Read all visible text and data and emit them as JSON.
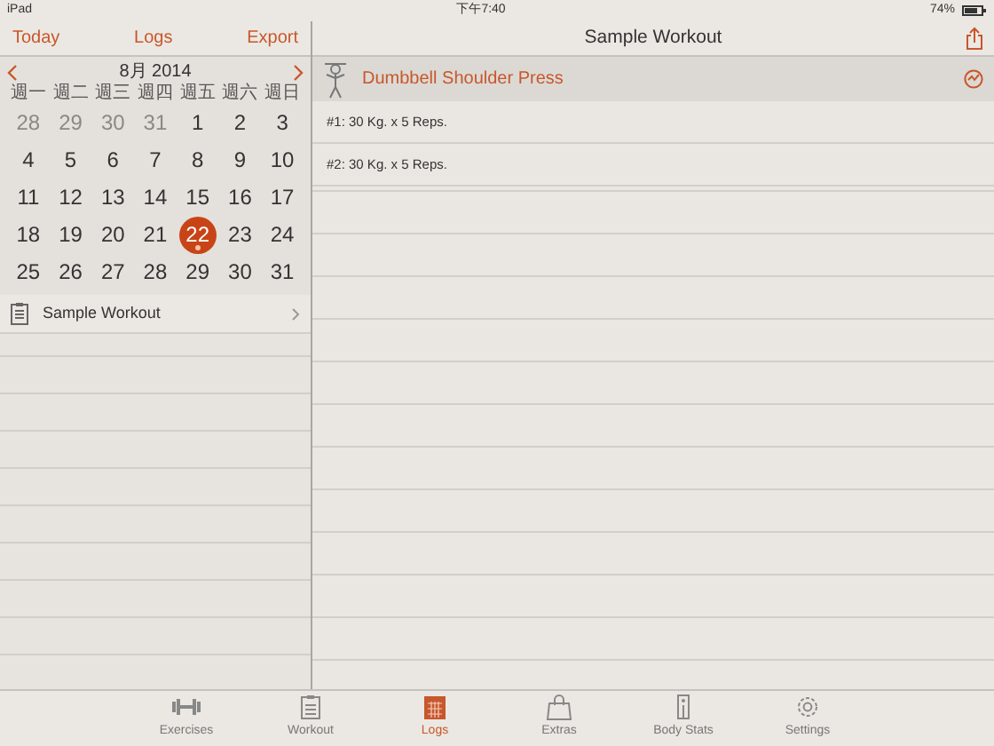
{
  "status_bar": {
    "device": "iPad",
    "time": "下午7:40",
    "battery": "74%"
  },
  "left_nav": {
    "buttons": [
      "Today",
      "Logs",
      "Export"
    ]
  },
  "calendar": {
    "month": "8月 2014",
    "weekdays": [
      "週一",
      "週二",
      "週三",
      "週四",
      "週五",
      "週六",
      "週日"
    ],
    "weeks": [
      [
        {
          "label": "28",
          "muted": true,
          "selected": false,
          "has_log": false
        },
        {
          "label": "29",
          "muted": true,
          "selected": false,
          "has_log": false
        },
        {
          "label": "30",
          "muted": true,
          "selected": false,
          "has_log": false
        },
        {
          "label": "31",
          "muted": true,
          "selected": false,
          "has_log": false
        },
        {
          "label": "1",
          "muted": false,
          "selected": false,
          "has_log": false
        },
        {
          "label": "2",
          "muted": false,
          "selected": false,
          "has_log": false
        },
        {
          "label": "3",
          "muted": false,
          "selected": false,
          "has_log": false
        }
      ],
      [
        {
          "label": "4",
          "muted": false,
          "selected": false,
          "has_log": false
        },
        {
          "label": "5",
          "muted": false,
          "selected": false,
          "has_log": false
        },
        {
          "label": "6",
          "muted": false,
          "selected": false,
          "has_log": false
        },
        {
          "label": "7",
          "muted": false,
          "selected": false,
          "has_log": false
        },
        {
          "label": "8",
          "muted": false,
          "selected": false,
          "has_log": false
        },
        {
          "label": "9",
          "muted": false,
          "selected": false,
          "has_log": false
        },
        {
          "label": "10",
          "muted": false,
          "selected": false,
          "has_log": false
        }
      ],
      [
        {
          "label": "11",
          "muted": false,
          "selected": false,
          "has_log": false
        },
        {
          "label": "12",
          "muted": false,
          "selected": false,
          "has_log": false
        },
        {
          "label": "13",
          "muted": false,
          "selected": false,
          "has_log": false
        },
        {
          "label": "14",
          "muted": false,
          "selected": false,
          "has_log": false
        },
        {
          "label": "15",
          "muted": false,
          "selected": false,
          "has_log": false
        },
        {
          "label": "16",
          "muted": false,
          "selected": false,
          "has_log": false
        },
        {
          "label": "17",
          "muted": false,
          "selected": false,
          "has_log": false
        }
      ],
      [
        {
          "label": "18",
          "muted": false,
          "selected": false,
          "has_log": false
        },
        {
          "label": "19",
          "muted": false,
          "selected": false,
          "has_log": false
        },
        {
          "label": "20",
          "muted": false,
          "selected": false,
          "has_log": false
        },
        {
          "label": "21",
          "muted": false,
          "selected": false,
          "has_log": false
        },
        {
          "label": "22",
          "muted": false,
          "selected": true,
          "has_log": true
        },
        {
          "label": "23",
          "muted": false,
          "selected": false,
          "has_log": false
        },
        {
          "label": "24",
          "muted": false,
          "selected": false,
          "has_log": false
        }
      ],
      [
        {
          "label": "25",
          "muted": false,
          "selected": false,
          "has_log": false
        },
        {
          "label": "26",
          "muted": false,
          "selected": false,
          "has_log": false
        },
        {
          "label": "27",
          "muted": false,
          "selected": false,
          "has_log": false
        },
        {
          "label": "28",
          "muted": false,
          "selected": false,
          "has_log": false
        },
        {
          "label": "29",
          "muted": false,
          "selected": false,
          "has_log": false
        },
        {
          "label": "30",
          "muted": false,
          "selected": false,
          "has_log": false
        },
        {
          "label": "31",
          "muted": false,
          "selected": false,
          "has_log": false
        }
      ]
    ]
  },
  "workouts": [
    {
      "name": "Sample Workout"
    }
  ],
  "detail": {
    "title": "Sample Workout",
    "exercise": "Dumbbell Shoulder Press",
    "sets": [
      "#1: 30 Kg. x 5 Reps.",
      "#2: 30 Kg. x 5 Reps."
    ]
  },
  "tab_bar": [
    {
      "label": "Exercises",
      "kind": "dumbbell",
      "selected": false
    },
    {
      "label": "Workout",
      "kind": "clipboard",
      "selected": false
    },
    {
      "label": "Logs",
      "kind": "calendar",
      "selected": true
    },
    {
      "label": "Extras",
      "kind": "bag",
      "selected": false
    },
    {
      "label": "Body Stats",
      "kind": "scale",
      "selected": false
    },
    {
      "label": "Settings",
      "kind": "gear",
      "selected": false
    }
  ]
}
